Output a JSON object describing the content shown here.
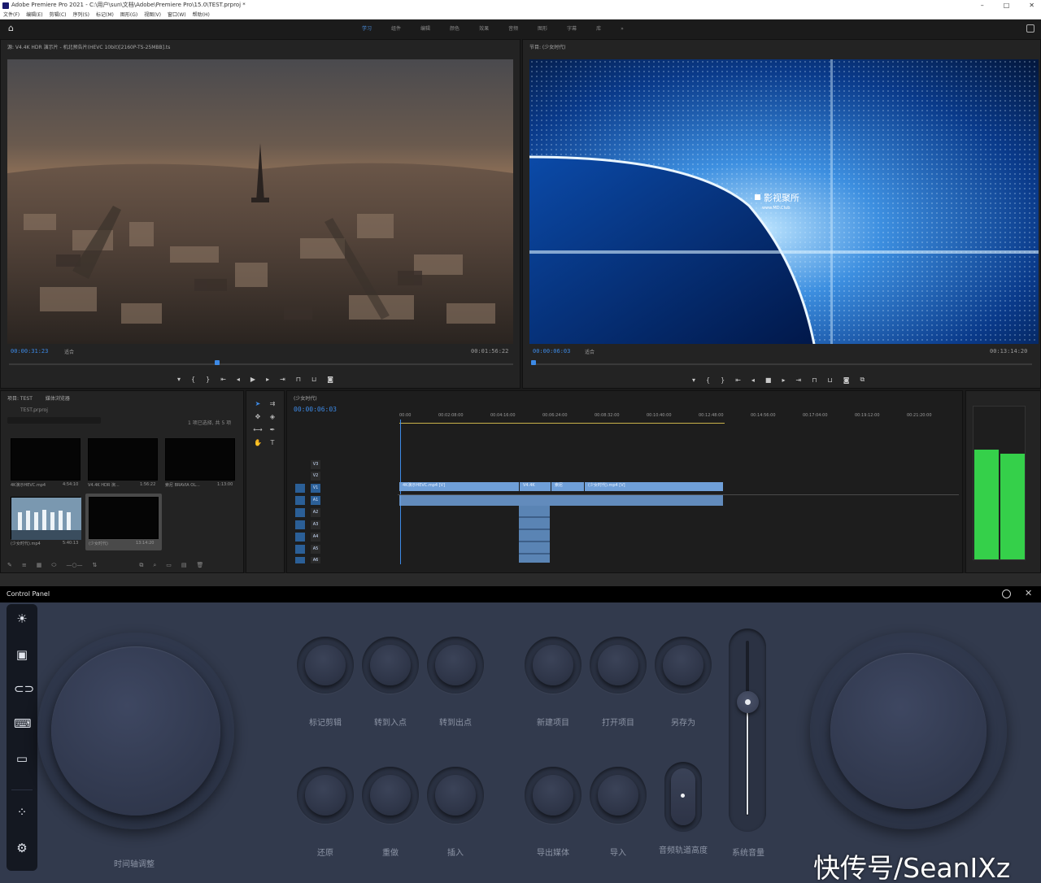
{
  "window": {
    "title": "Adobe Premiere Pro 2021 - C:\\用户\\sun\\文档\\Adobe\\Premiere Pro\\15.0\\TEST.prproj *",
    "menu": [
      "文件(F)",
      "编辑(E)",
      "剪辑(C)",
      "序列(S)",
      "标记(M)",
      "图形(G)",
      "视图(V)",
      "窗口(W)",
      "帮助(H)"
    ]
  },
  "workspace": {
    "tabs": [
      "学习",
      "组件",
      "编辑",
      "颜色",
      "效果",
      "音频",
      "图形",
      "字幕",
      "库"
    ],
    "active": "学习"
  },
  "source_monitor": {
    "tab": "源: V4.4K HDR 演示片 - 机北预告片(HEVC 10bit)[2160P-TS-25MBB].ts",
    "timecode": "00:00:31:23",
    "fit": "适合",
    "duration": "00:01:56:22"
  },
  "program_monitor": {
    "tab": "节目: (少女时代)",
    "timecode": "00:00:06:03",
    "fit": "适合",
    "duration": "00:13:14:20",
    "overlay_brand": "影视聚所",
    "overlay_url": "www.MD.Club"
  },
  "project": {
    "tabs": [
      "项目: TEST",
      "媒体浏览器"
    ],
    "file": "TEST.prproj",
    "count": "1 项已选择, 共 5 项",
    "items": [
      {
        "name": "4K演示HEVC.mp4",
        "length": "4:54:10"
      },
      {
        "name": "V4.4K HDR 演...",
        "length": "1:56:22"
      },
      {
        "name": "索尼 BRAVIA OL...",
        "length": "1:13:00"
      },
      {
        "name": "(少女时代).mp4",
        "length": "5:40:13"
      },
      {
        "name": "(少女时代)",
        "length": "13:14:20"
      }
    ]
  },
  "timeline": {
    "tab": "(少女时代)",
    "timecode": "00:00:06:03",
    "ruler": [
      "00:00",
      "00:02:08:00",
      "00:04:16:00",
      "00:06:24:00",
      "00:08:32:00",
      "00:10:40:00",
      "00:12:48:00",
      "00:14:56:00",
      "00:17:04:00",
      "00:19:12:00",
      "00:21:20:00"
    ],
    "tracks": [
      "V3",
      "V2",
      "V1",
      "A1",
      "A2",
      "A3",
      "A4",
      "A5",
      "A6"
    ],
    "clips": [
      "4K演示HEVC.mp4 [V]",
      "V4.4K",
      "索尼",
      "(少女时代).mp4 [V]"
    ]
  },
  "control_panel": {
    "title": "Control Panel",
    "buttons_row1": [
      "标记剪辑",
      "转到入点",
      "转到出点",
      "新建项目",
      "打开项目",
      "另存为"
    ],
    "buttons_row2": [
      "还原",
      "重做",
      "插入",
      "导出媒体",
      "导入"
    ],
    "toggle_label": "音频轨道高度",
    "slider_label": "系统音量",
    "left_dial_label": "时间轴调整"
  },
  "watermark": "快传号/SeanIXz",
  "colors": {
    "accent": "#3d8ae6",
    "meter": "#35d04a",
    "panel_bg": "#323a4d"
  }
}
